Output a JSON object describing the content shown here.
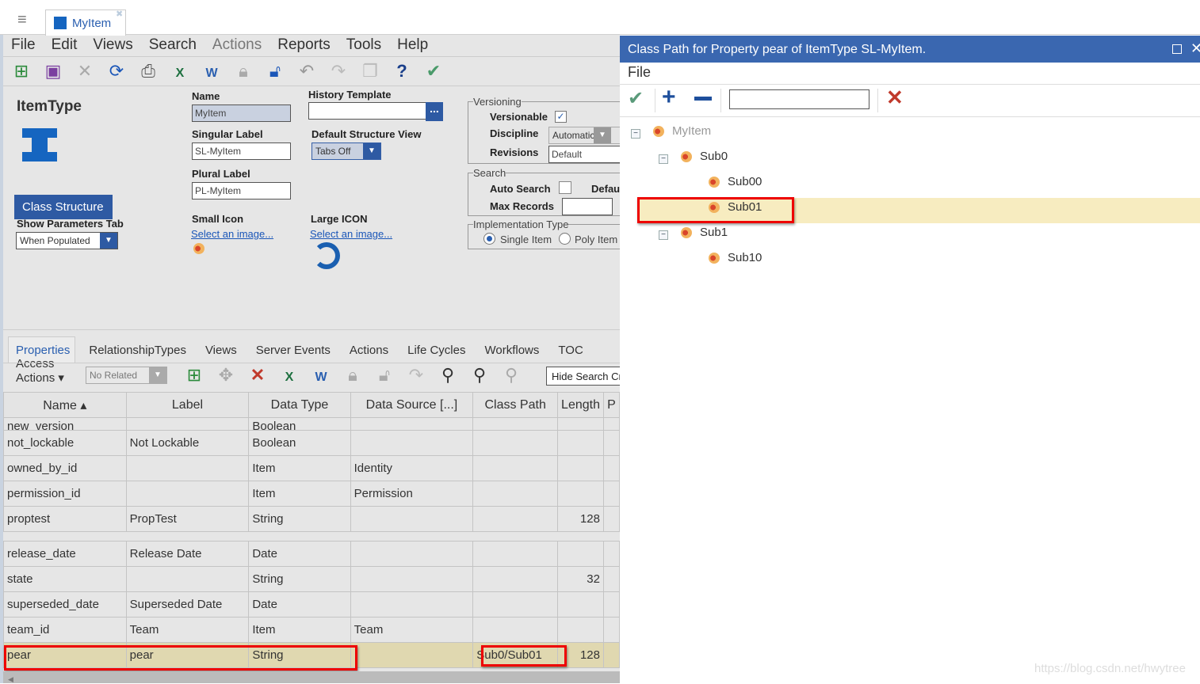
{
  "tab": {
    "title": "MyItem"
  },
  "menu": [
    "File",
    "Edit",
    "Views",
    "Search",
    "Actions",
    "Reports",
    "Tools",
    "Help"
  ],
  "form": {
    "heading": "ItemType",
    "name_label": "Name",
    "name_value": "MyItem",
    "singular_label": "Singular Label",
    "singular_value": "SL-MyItem",
    "plural_label": "Plural Label",
    "plural_value": "PL-MyItem",
    "history_label": "History Template",
    "history_value": "",
    "history_btn": "...",
    "structure_view_label": "Default Structure View",
    "structure_view_value": "Tabs Off",
    "class_structure_btn": "Class Structure",
    "show_params_label": "Show Parameters Tab",
    "show_params_value": "When Populated",
    "small_icon_label": "Small Icon",
    "small_icon_link": "Select an image...",
    "large_icon_label": "Large ICON",
    "large_icon_link": "Select an image...",
    "versioning": {
      "legend": "Versioning",
      "versionable": "Versionable",
      "versionable_checked": true,
      "discipline": "Discipline",
      "discipline_value": "Automatic",
      "revisions": "Revisions",
      "revisions_value": "Default"
    },
    "search": {
      "legend": "Search",
      "auto_search": "Auto Search",
      "auto_search_checked": false,
      "default_label": "Defau",
      "max_records": "Max Records",
      "max_records_value": ""
    },
    "impl": {
      "legend": "Implementation Type",
      "single": "Single Item",
      "poly": "Poly Item",
      "selected": "Single Item"
    }
  },
  "rel_tabs": [
    "Properties",
    "RelationshipTypes",
    "Views",
    "Server Events",
    "Actions",
    "Life Cycles",
    "Workflows",
    "TOC Access"
  ],
  "rel_toolbar": {
    "actions": "Actions",
    "related": "No Related",
    "hide_search": "Hide Search Cr"
  },
  "grid": {
    "columns": [
      "Name ▴",
      "Label",
      "Data Type",
      "Data Source [...]",
      "Class Path",
      "Length",
      "P"
    ],
    "partial_row": [
      "new_version",
      "",
      "Boolean",
      "",
      "",
      "",
      ""
    ],
    "rows": [
      [
        "not_lockable",
        "Not Lockable",
        "Boolean",
        "",
        "",
        ""
      ],
      [
        "owned_by_id",
        "",
        "Item",
        "Identity",
        "",
        ""
      ],
      [
        "permission_id",
        "",
        "Item",
        "Permission",
        "",
        ""
      ],
      [
        "proptest",
        "PropTest",
        "String",
        "",
        "",
        "128"
      ],
      [
        "release_date",
        "Release Date",
        "Date",
        "",
        "",
        ""
      ],
      [
        "state",
        "",
        "String",
        "",
        "",
        "32"
      ],
      [
        "superseded_date",
        "Superseded Date",
        "Date",
        "",
        "",
        ""
      ],
      [
        "team_id",
        "Team",
        "Item",
        "Team",
        "",
        ""
      ],
      [
        "pear",
        "pear",
        "String",
        "",
        "Sub0/Sub01",
        "128"
      ]
    ]
  },
  "dialog": {
    "title": "Class Path for Property pear of ItemType SL-MyItem.",
    "menu": "File",
    "search_value": "",
    "tree": [
      {
        "label": "MyItem",
        "level": 0
      },
      {
        "label": "Sub0",
        "level": 1
      },
      {
        "label": "Sub00",
        "level": 2
      },
      {
        "label": "Sub01",
        "level": 2,
        "selected": true
      },
      {
        "label": "Sub1",
        "level": 1
      },
      {
        "label": "Sub10",
        "level": 2
      }
    ]
  },
  "watermark": "https://blog.csdn.net/hwytree",
  "colors": {
    "accent": "#2e5aa3",
    "dialog_title": "#3a67b0",
    "selection": "#f7ecc0",
    "highlight_box": "#e00000"
  }
}
